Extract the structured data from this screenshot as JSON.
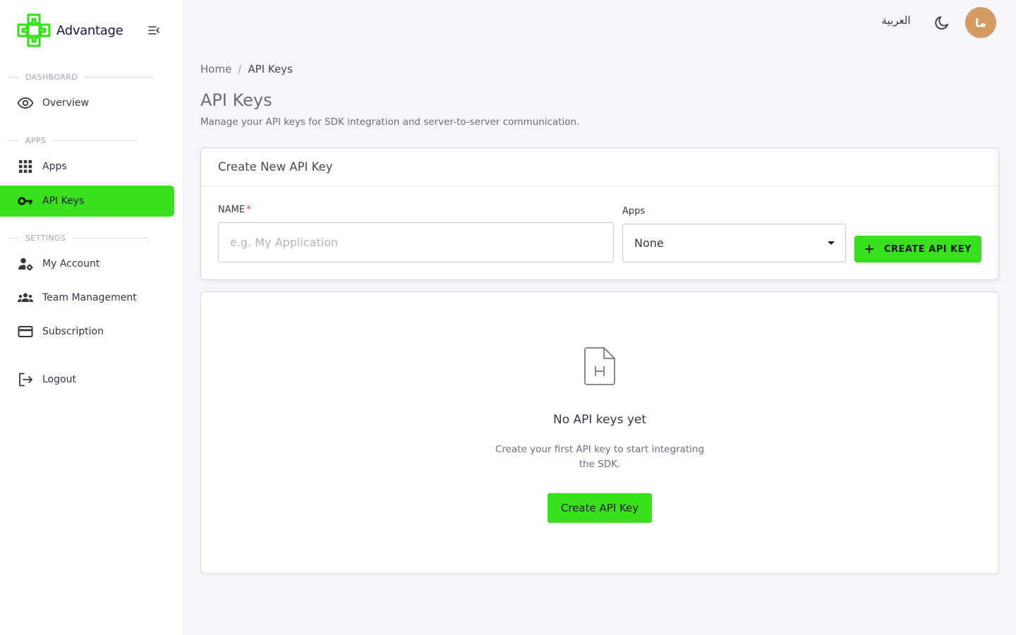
{
  "brand": {
    "name": "Advantage",
    "accent_color": "#39e01e"
  },
  "sidebar": {
    "sections": [
      {
        "title": "DASHBOARD"
      },
      {
        "title": "APPS"
      },
      {
        "title": "SETTINGS"
      }
    ],
    "items": [
      {
        "label": "Overview",
        "icon": "eye-icon"
      },
      {
        "label": "Apps",
        "icon": "grid-icon"
      },
      {
        "label": "API Keys",
        "icon": "key-icon",
        "active": true
      },
      {
        "label": "My Account",
        "icon": "user-settings-icon"
      },
      {
        "label": "Team Management",
        "icon": "team-icon"
      },
      {
        "label": "Subscription",
        "icon": "credit-card-icon"
      },
      {
        "label": "Logout",
        "icon": "logout-icon"
      }
    ]
  },
  "topbar": {
    "language_label": "العربية",
    "theme_icon": "moon-icon",
    "avatar_initials": "ما",
    "avatar_color": "#d49b62"
  },
  "breadcrumb": {
    "home": "Home",
    "separator": "/",
    "current": "API Keys"
  },
  "page": {
    "title": "API Keys",
    "subtitle": "Manage your API keys for SDK integration and server-to-server communication."
  },
  "create_form": {
    "title": "Create New API Key",
    "name_label": "NAME",
    "required_mark": "*",
    "name_placeholder": "e.g. My Application",
    "apps_label": "Apps",
    "apps_value": "None",
    "submit_label": "CREATE API KEY"
  },
  "empty_state": {
    "icon": "file-h-icon",
    "title": "No API keys yet",
    "description": "Create your first API key to start integrating the SDK.",
    "button_label": "Create API Key"
  }
}
